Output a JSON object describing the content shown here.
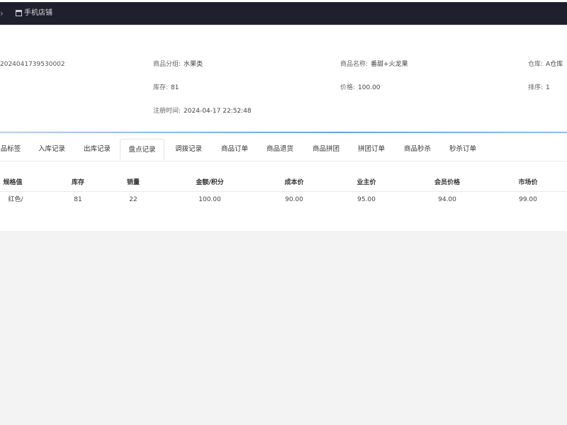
{
  "topbar": {
    "back_icon": "chevron-icon",
    "shop_icon": "store-icon",
    "shop_label": "手机店铺"
  },
  "product": {
    "code": "2024041739530002",
    "category_label": "商品分组:",
    "category_value": "水果类",
    "name_label": "商品名称:",
    "name_value": "番甜+火龙果",
    "warehouse_label": "仓库:",
    "warehouse_value": "A仓库",
    "stock_label": "库存:",
    "stock_value": "81",
    "price_label": "价格:",
    "price_value": "100.00",
    "sort_label": "排序:",
    "sort_value": "1",
    "reg_time_label": "注册时间:",
    "reg_time_value": "2024-04-17 22:52:48"
  },
  "tabs": [
    {
      "label": "品标签"
    },
    {
      "label": "入库记录"
    },
    {
      "label": "出库记录"
    },
    {
      "label": "盘点记录",
      "active": true
    },
    {
      "label": "调拨记录"
    },
    {
      "label": "商品订单"
    },
    {
      "label": "商品退货"
    },
    {
      "label": "商品拼团"
    },
    {
      "label": "拼团订单"
    },
    {
      "label": "商品秒杀"
    },
    {
      "label": "秒杀订单"
    }
  ],
  "table": {
    "headers": [
      "规格值",
      "库存",
      "销量",
      "金额/积分",
      "成本价",
      "业主价",
      "会员价格",
      "市场价"
    ],
    "rows": [
      [
        "红色/",
        "81",
        "22",
        "100.00",
        "90.00",
        "95.00",
        "94.00",
        "99.00"
      ]
    ]
  },
  "colors": {
    "topbar_bg": "#1f1f2e",
    "accent_line": "#6fa3db",
    "page_bg": "#f3f3f4"
  }
}
